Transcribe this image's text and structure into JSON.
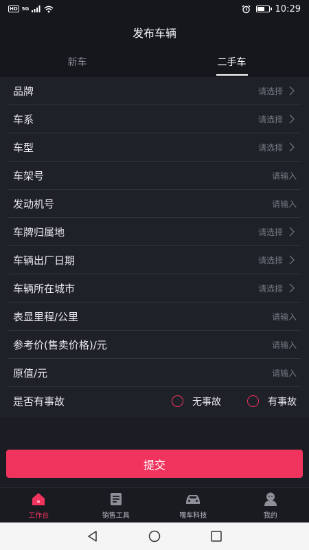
{
  "status_bar": {
    "network_badge": "HD",
    "signal_badge": "5G",
    "time": "10:29",
    "battery_level": 0.6
  },
  "header": {
    "title": "发布车辆"
  },
  "tabs": [
    {
      "label": "新车",
      "active": false
    },
    {
      "label": "二手车",
      "active": true
    }
  ],
  "form": {
    "rows": [
      {
        "label": "品牌",
        "hint": "请选择",
        "type": "select"
      },
      {
        "label": "车系",
        "hint": "请选择",
        "type": "select"
      },
      {
        "label": "车型",
        "hint": "请选择",
        "type": "select"
      },
      {
        "label": "车架号",
        "hint": "请输入",
        "type": "input"
      },
      {
        "label": "发动机号",
        "hint": "请输入",
        "type": "input"
      },
      {
        "label": "车牌归属地",
        "hint": "请选择",
        "type": "select"
      },
      {
        "label": "车辆出厂日期",
        "hint": "请选择",
        "type": "select"
      },
      {
        "label": "车辆所在城市",
        "hint": "请选择",
        "type": "select"
      },
      {
        "label": "表显里程/公里",
        "hint": "请输入",
        "type": "input"
      },
      {
        "label": "参考价(售卖价格)/元",
        "hint": "请输入",
        "type": "input"
      },
      {
        "label": "原值/元",
        "hint": "请输入",
        "type": "input"
      }
    ],
    "accident": {
      "label": "是否有事故",
      "options": [
        "无事故",
        "有事故"
      ]
    }
  },
  "submit_label": "提交",
  "bottom_nav": [
    {
      "label": "工作台",
      "icon": "home-icon",
      "active": true
    },
    {
      "label": "销售工具",
      "icon": "document-icon",
      "active": false
    },
    {
      "label": "嘿车科技",
      "icon": "car-icon",
      "active": false
    },
    {
      "label": "我的",
      "icon": "user-icon",
      "active": false
    }
  ],
  "colors": {
    "accent": "#f0345e",
    "background": "#15161c",
    "form_background": "#1f2129"
  }
}
